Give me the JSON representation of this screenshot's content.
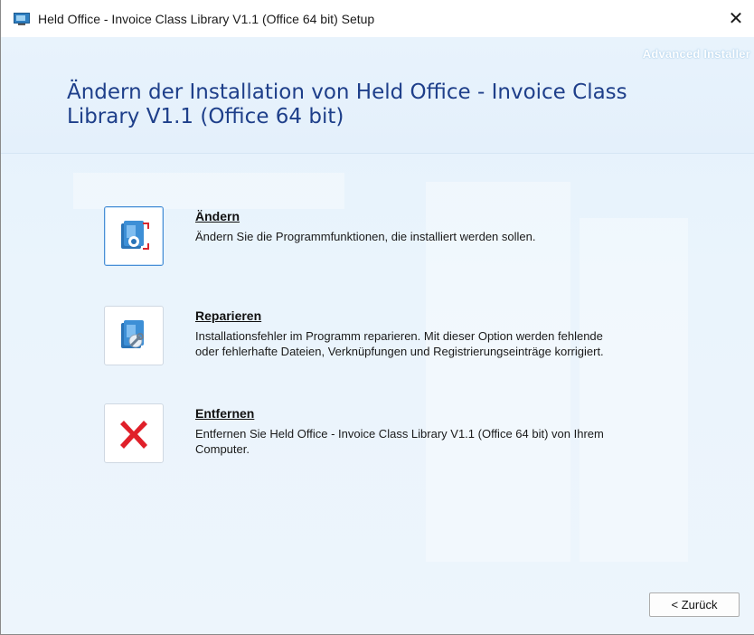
{
  "window": {
    "title": "Held Office - Invoice Class Library V1.1 (Office 64 bit) Setup",
    "close_glyph": "✕",
    "icon": "installer-app-icon"
  },
  "header": {
    "brand": "Advanced Installer",
    "heading": "Ändern der Installation von Held Office - Invoice Class Library V1.1 (Office 64 bit)"
  },
  "options": [
    {
      "title": "Ändern",
      "description": "Ändern Sie die Programmfunktionen, die installiert werden sollen.",
      "icon": "modify-icon"
    },
    {
      "title": "Reparieren",
      "description": "Installationsfehler im Programm reparieren. Mit dieser Option werden fehlende oder fehlerhafte Dateien, Verknüpfungen und Registrierungseinträge korrigiert.",
      "icon": "repair-icon"
    },
    {
      "title": "Entfernen",
      "description": "Entfernen Sie Held Office - Invoice Class Library V1.1 (Office 64 bit) von Ihrem Computer.",
      "icon": "remove-icon"
    }
  ],
  "footer": {
    "back_label": "< Zurück"
  },
  "colors": {
    "heading": "#1e3f8a",
    "background": "#e8f3fc",
    "remove_x": "#e0202a",
    "focus_border": "#4a8fd6"
  }
}
